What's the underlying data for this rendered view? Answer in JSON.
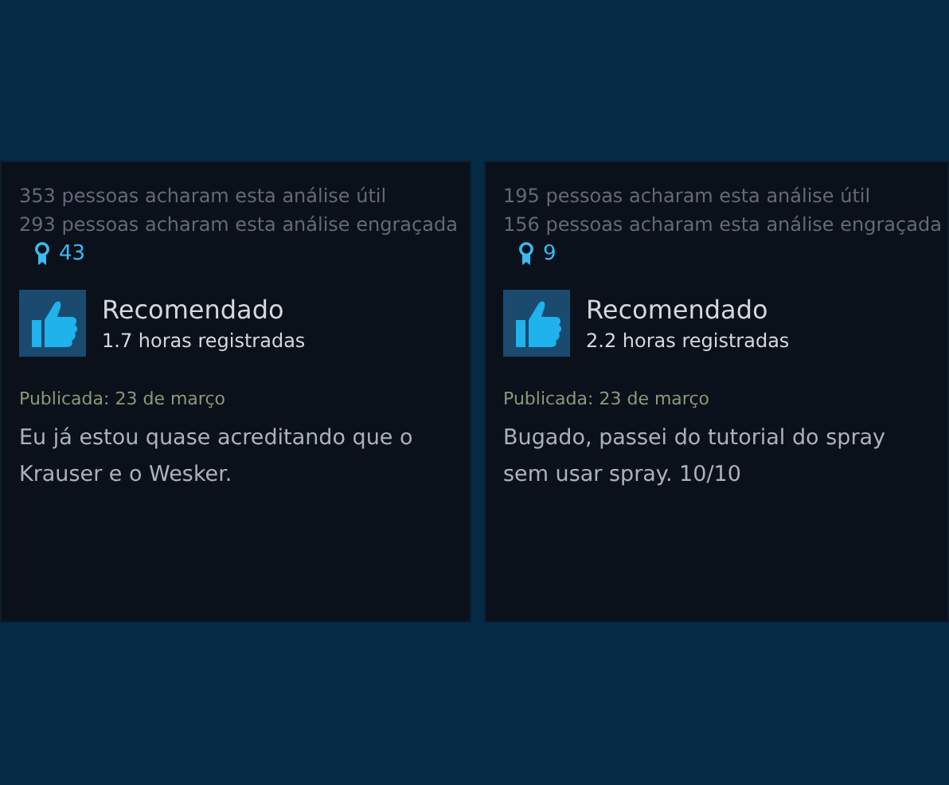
{
  "reviews": [
    {
      "helpful": "353 pessoas acharam esta análise útil",
      "funny": "293 pessoas acharam esta análise engraçada",
      "awards": "43",
      "recommended": true,
      "verdict": "Recomendado",
      "hours": "1.7 horas registradas",
      "posted": "Publicada: 23 de março",
      "body": "Eu já estou quase acreditando que o Krauser e o Wesker."
    },
    {
      "helpful": "195 pessoas acharam esta análise útil",
      "funny": "156 pessoas acharam esta análise engraçada",
      "awards": "9",
      "recommended": true,
      "verdict": "Recomendado",
      "hours": "2.2 horas registradas",
      "posted": "Publicada: 23 de março",
      "body": "Bugado, passei do tutorial do spray sem usar spray. 10/10"
    }
  ]
}
